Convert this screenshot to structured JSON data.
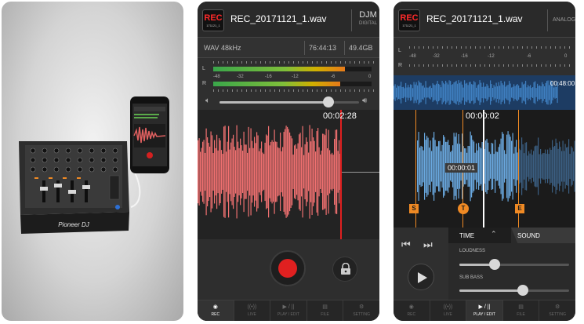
{
  "panel1": {
    "brand_text": "Pioneer DJ"
  },
  "panel2": {
    "rec_badge_label": "REC",
    "rec_badge_sub": "171121_1",
    "filename": "REC_20171121_1.wav",
    "mixer_name": "DJM",
    "mixer_sub": "DIGITAL",
    "format": "WAV 48kHz",
    "remaining_time": "76:44:13",
    "free_space": "49.4GB",
    "meter_scale": [
      "-48",
      "-32",
      "-16",
      "-12",
      "-6",
      "0"
    ],
    "channel_left": "L",
    "channel_right": "R",
    "meter_left_level": 0.83,
    "meter_right_level": 0.8,
    "volume_level": 0.78,
    "elapsed_time": "00:02:28",
    "tabs": [
      {
        "icon": "◉",
        "label": "REC",
        "active": true
      },
      {
        "icon": "((•))",
        "label": "LIVE",
        "active": false
      },
      {
        "icon": "▶ / ||",
        "label": "PLAY / EDIT",
        "active": false
      },
      {
        "icon": "▤",
        "label": "FILE",
        "active": false
      },
      {
        "icon": "⚙",
        "label": "SETTING",
        "active": false
      }
    ]
  },
  "panel3": {
    "rec_badge_label": "REC",
    "rec_badge_sub": "171121_1",
    "filename": "REC_20171121_1.wav",
    "mixer_name": "ANALOG",
    "meter_scale": [
      "-48",
      "-32",
      "-16",
      "-12",
      "-6",
      "0"
    ],
    "channel_left": "L",
    "channel_right": "R",
    "total_time": "00:48:00",
    "position_time": "00:00:02",
    "cursor_time": "00:00:01",
    "marker_start": "S",
    "marker_t": "T",
    "marker_end": "E",
    "edit_tab_time": "TIME",
    "edit_tab_sound": "SOUND",
    "loudness_label": "LOUDNESS",
    "sub_bass_label": "SUB BASS",
    "loudness_level": 0.32,
    "sub_bass_level": 0.58,
    "tabs": [
      {
        "icon": "◉",
        "label": "REC",
        "active": false
      },
      {
        "icon": "((•))",
        "label": "LIVE",
        "active": false
      },
      {
        "icon": "▶ / ||",
        "label": "PLAY / EDIT",
        "active": true
      },
      {
        "icon": "▤",
        "label": "FILE",
        "active": false
      },
      {
        "icon": "⚙",
        "label": "SETTING",
        "active": false
      }
    ]
  },
  "colors": {
    "accent_red": "#e02020",
    "wave_red": "#f07070",
    "wave_blue": "#6aa9e0",
    "marker_orange": "#f08a24"
  }
}
